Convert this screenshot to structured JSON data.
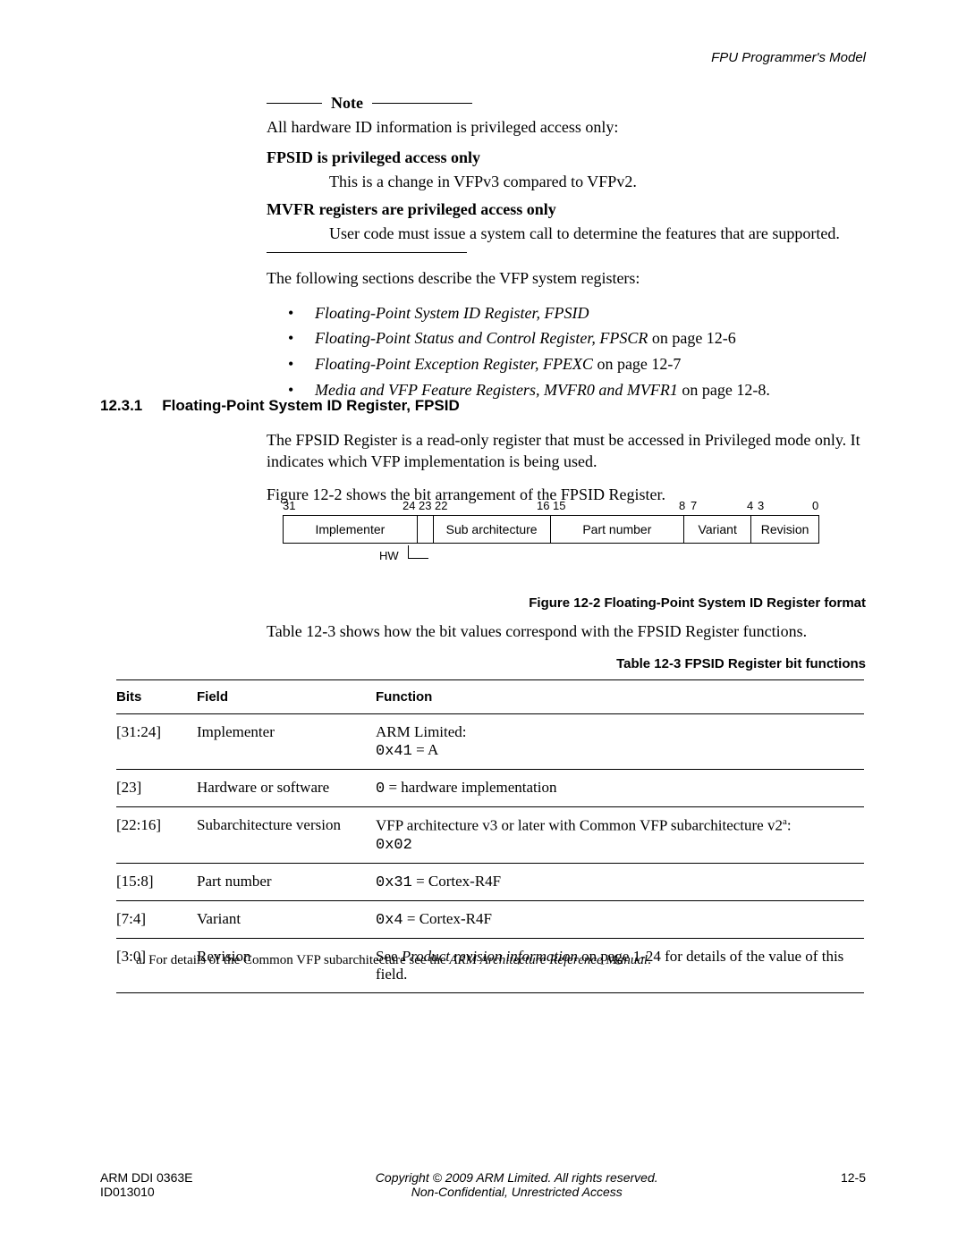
{
  "header": {
    "running": "FPU Programmer's Model"
  },
  "note": {
    "label": "Note",
    "lead": "All hardware ID information is privileged access only:"
  },
  "defs": {
    "fpsid_title": "FPSID is privileged access only",
    "fpsid_body": "This is a change in VFPv3 compared to VFPv2.",
    "mvfr_title": "MVFR registers are privileged access only",
    "mvfr_body": "User code must issue a system call to determine the features that are supported."
  },
  "reflist": {
    "lead": "The following sections describe the VFP system registers:",
    "items": [
      {
        "ital": "Floating-Point System ID Register, FPSID",
        "tail": ""
      },
      {
        "ital": "Floating-Point Status and Control Register, FPSCR",
        "tail": " on page 12-6"
      },
      {
        "ital": "Floating-Point Exception Register, FPEXC",
        "tail": " on page 12-7"
      },
      {
        "ital": "Media and VFP Feature Registers, MVFR0 and MVFR1",
        "tail": " on page 12-8."
      }
    ]
  },
  "section": {
    "num": "12.3.1",
    "title": "Floating-Point System ID Register, FPSID",
    "p1": "The FPSID Register is a read-only register that must be accessed in Privileged mode only. It indicates which VFP implementation is being used.",
    "p2": "Figure 12-2 shows the bit arrangement of the FPSID Register."
  },
  "bitfig": {
    "nums": {
      "n31": "31",
      "n24": "24",
      "n23": "23",
      "n22": "22",
      "n16": "16",
      "n15": "15",
      "n8": "8",
      "n7": "7",
      "n4": "4",
      "n3": "3",
      "n0": "0"
    },
    "fields": {
      "implementer": "Implementer",
      "hw": "HW",
      "sub": "Sub architecture",
      "part": "Part number",
      "variant": "Variant",
      "revision": "Revision"
    },
    "caption": "Figure 12-2 Floating-Point System ID Register format"
  },
  "table": {
    "lead": "Table 12-3 shows how the bit values correspond with the FPSID Register functions.",
    "caption": "Table 12-3 FPSID Register bit functions",
    "head": {
      "bits": "Bits",
      "field": "Field",
      "func": "Function"
    },
    "rows": [
      {
        "bits": "[31:24]",
        "field": "Implementer",
        "l1": "ARM Limited:",
        "code": "0x41",
        "after": " = A"
      },
      {
        "bits": "[23]",
        "field": "Hardware or software",
        "code": "0",
        "after": " = hardware implementation"
      },
      {
        "bits": "[22:16]",
        "field": "Subarchitecture version",
        "pre": "VFP architecture v3 or later with Common VFP subarchitecture v2",
        "sup": "a",
        "post": ":",
        "code": "0x02"
      },
      {
        "bits": "[15:8]",
        "field": "Part number",
        "code": "0x31",
        "after": " = Cortex-R4F"
      },
      {
        "bits": "[7:4]",
        "field": "Variant",
        "code": "0x4",
        "after": " = Cortex-R4F"
      },
      {
        "bits": "[3:0]",
        "field": "Revision",
        "plain_pre": "See ",
        "ital": "Product revision information",
        "plain_post": " on page 1-24 for details of the value of this field."
      }
    ],
    "footnote_a_pre": "a.   For details of the Common VFP subarchitecture see the ",
    "footnote_a_ital": "ARM Architecture Reference Manual",
    "footnote_a_post": "."
  },
  "footer": {
    "left1": "ARM DDI 0363E",
    "left2": "ID013010",
    "center1": "Copyright © 2009 ARM Limited. All rights reserved.",
    "center2": "Non-Confidential, Unrestricted Access",
    "right": "12-5"
  }
}
